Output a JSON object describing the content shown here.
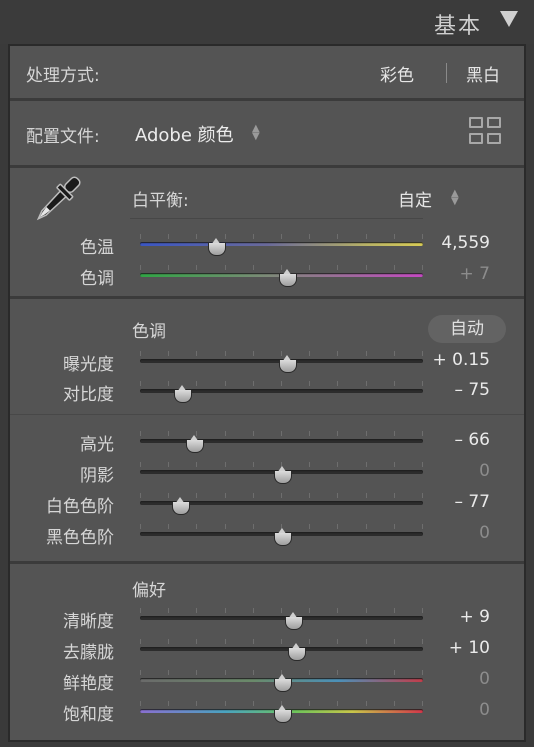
{
  "header": {
    "title": "基本"
  },
  "treatment": {
    "label": "处理方式:",
    "color_option": "彩色",
    "bw_option": "黑白"
  },
  "profile": {
    "label": "配置文件:",
    "value": "Adobe 颜色"
  },
  "white_balance": {
    "label": "白平衡:",
    "value": "自定",
    "sliders": [
      {
        "label": "色温",
        "value": "4,559",
        "position": 0.27,
        "dim": false,
        "track": "temp"
      },
      {
        "label": "色调",
        "value": "+ 7",
        "position": 0.52,
        "dim": true,
        "track": "tint"
      }
    ]
  },
  "tone": {
    "label": "色调",
    "auto_label": "自动",
    "sliders": [
      {
        "label": "曝光度",
        "value": "+ 0.15",
        "position": 0.52,
        "dim": false
      },
      {
        "label": "对比度",
        "value": "– 75",
        "position": 0.15,
        "dim": false
      },
      {
        "label": "高光",
        "value": "– 66",
        "position": 0.19,
        "dim": false
      },
      {
        "label": "阴影",
        "value": "0",
        "position": 0.5,
        "dim": true
      },
      {
        "label": "白色色阶",
        "value": "– 77",
        "position": 0.14,
        "dim": false
      },
      {
        "label": "黑色色阶",
        "value": "0",
        "position": 0.5,
        "dim": true
      }
    ]
  },
  "presence": {
    "label": "偏好",
    "sliders": [
      {
        "label": "清晰度",
        "value": "+ 9",
        "position": 0.54,
        "dim": false,
        "track": ""
      },
      {
        "label": "去朦胧",
        "value": "+ 10",
        "position": 0.55,
        "dim": false,
        "track": ""
      },
      {
        "label": "鲜艳度",
        "value": "0",
        "position": 0.5,
        "dim": true,
        "track": "vib"
      },
      {
        "label": "饱和度",
        "value": "0",
        "position": 0.5,
        "dim": true,
        "track": "sat"
      }
    ]
  },
  "icons": {
    "picker": "eyedropper-icon",
    "grid": "grid-view-icon",
    "collapse": "collapse-triangle-icon"
  }
}
